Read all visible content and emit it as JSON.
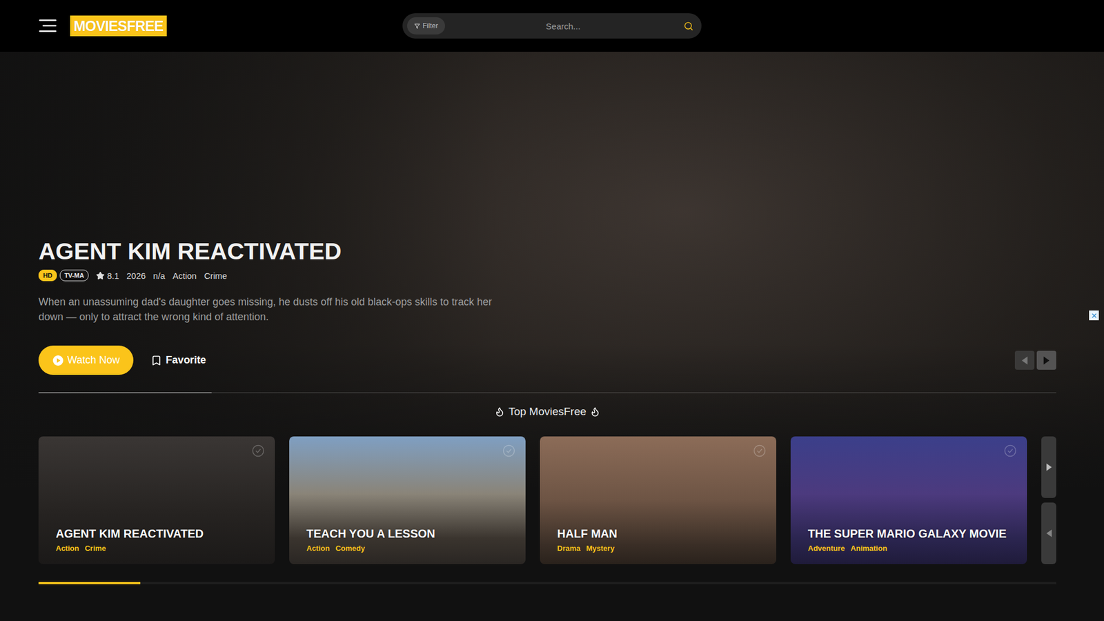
{
  "header": {
    "logo": "MOVIESFREE",
    "filter": "Filter",
    "search_placeholder": "Search..."
  },
  "hero": {
    "title": "AGENT KIM REACTIVATED",
    "badges": [
      {
        "label": "HD",
        "kind": "filled"
      },
      {
        "label": "TV-MA",
        "kind": "outline"
      }
    ],
    "rating": "8.1",
    "year": "2026",
    "duration": "n/a",
    "genres": [
      "Action",
      "Crime"
    ],
    "description": "When an unassuming dad's daughter goes missing, he dusts off his old black-ops skills to track her down — only to attract the wrong kind of attention.",
    "watch_button": "Watch Now",
    "favorite_button": "Favorite",
    "slide_level": 0.17
  },
  "top_section": {
    "title": "Top MoviesFree",
    "scroll_level": 0.1,
    "cards": [
      {
        "title": "AGENT KIM REACTIVATED",
        "genres": [
          "Action",
          "Crime"
        ]
      },
      {
        "title": "TEACH YOU A LESSON",
        "genres": [
          "Action",
          "Comedy"
        ]
      },
      {
        "title": "HALF MAN",
        "genres": [
          "Drama",
          "Mystery"
        ]
      },
      {
        "title": "THE SUPER MARIO GALAXY MOVIE",
        "genres": [
          "Adventure",
          "Animation"
        ]
      }
    ]
  }
}
